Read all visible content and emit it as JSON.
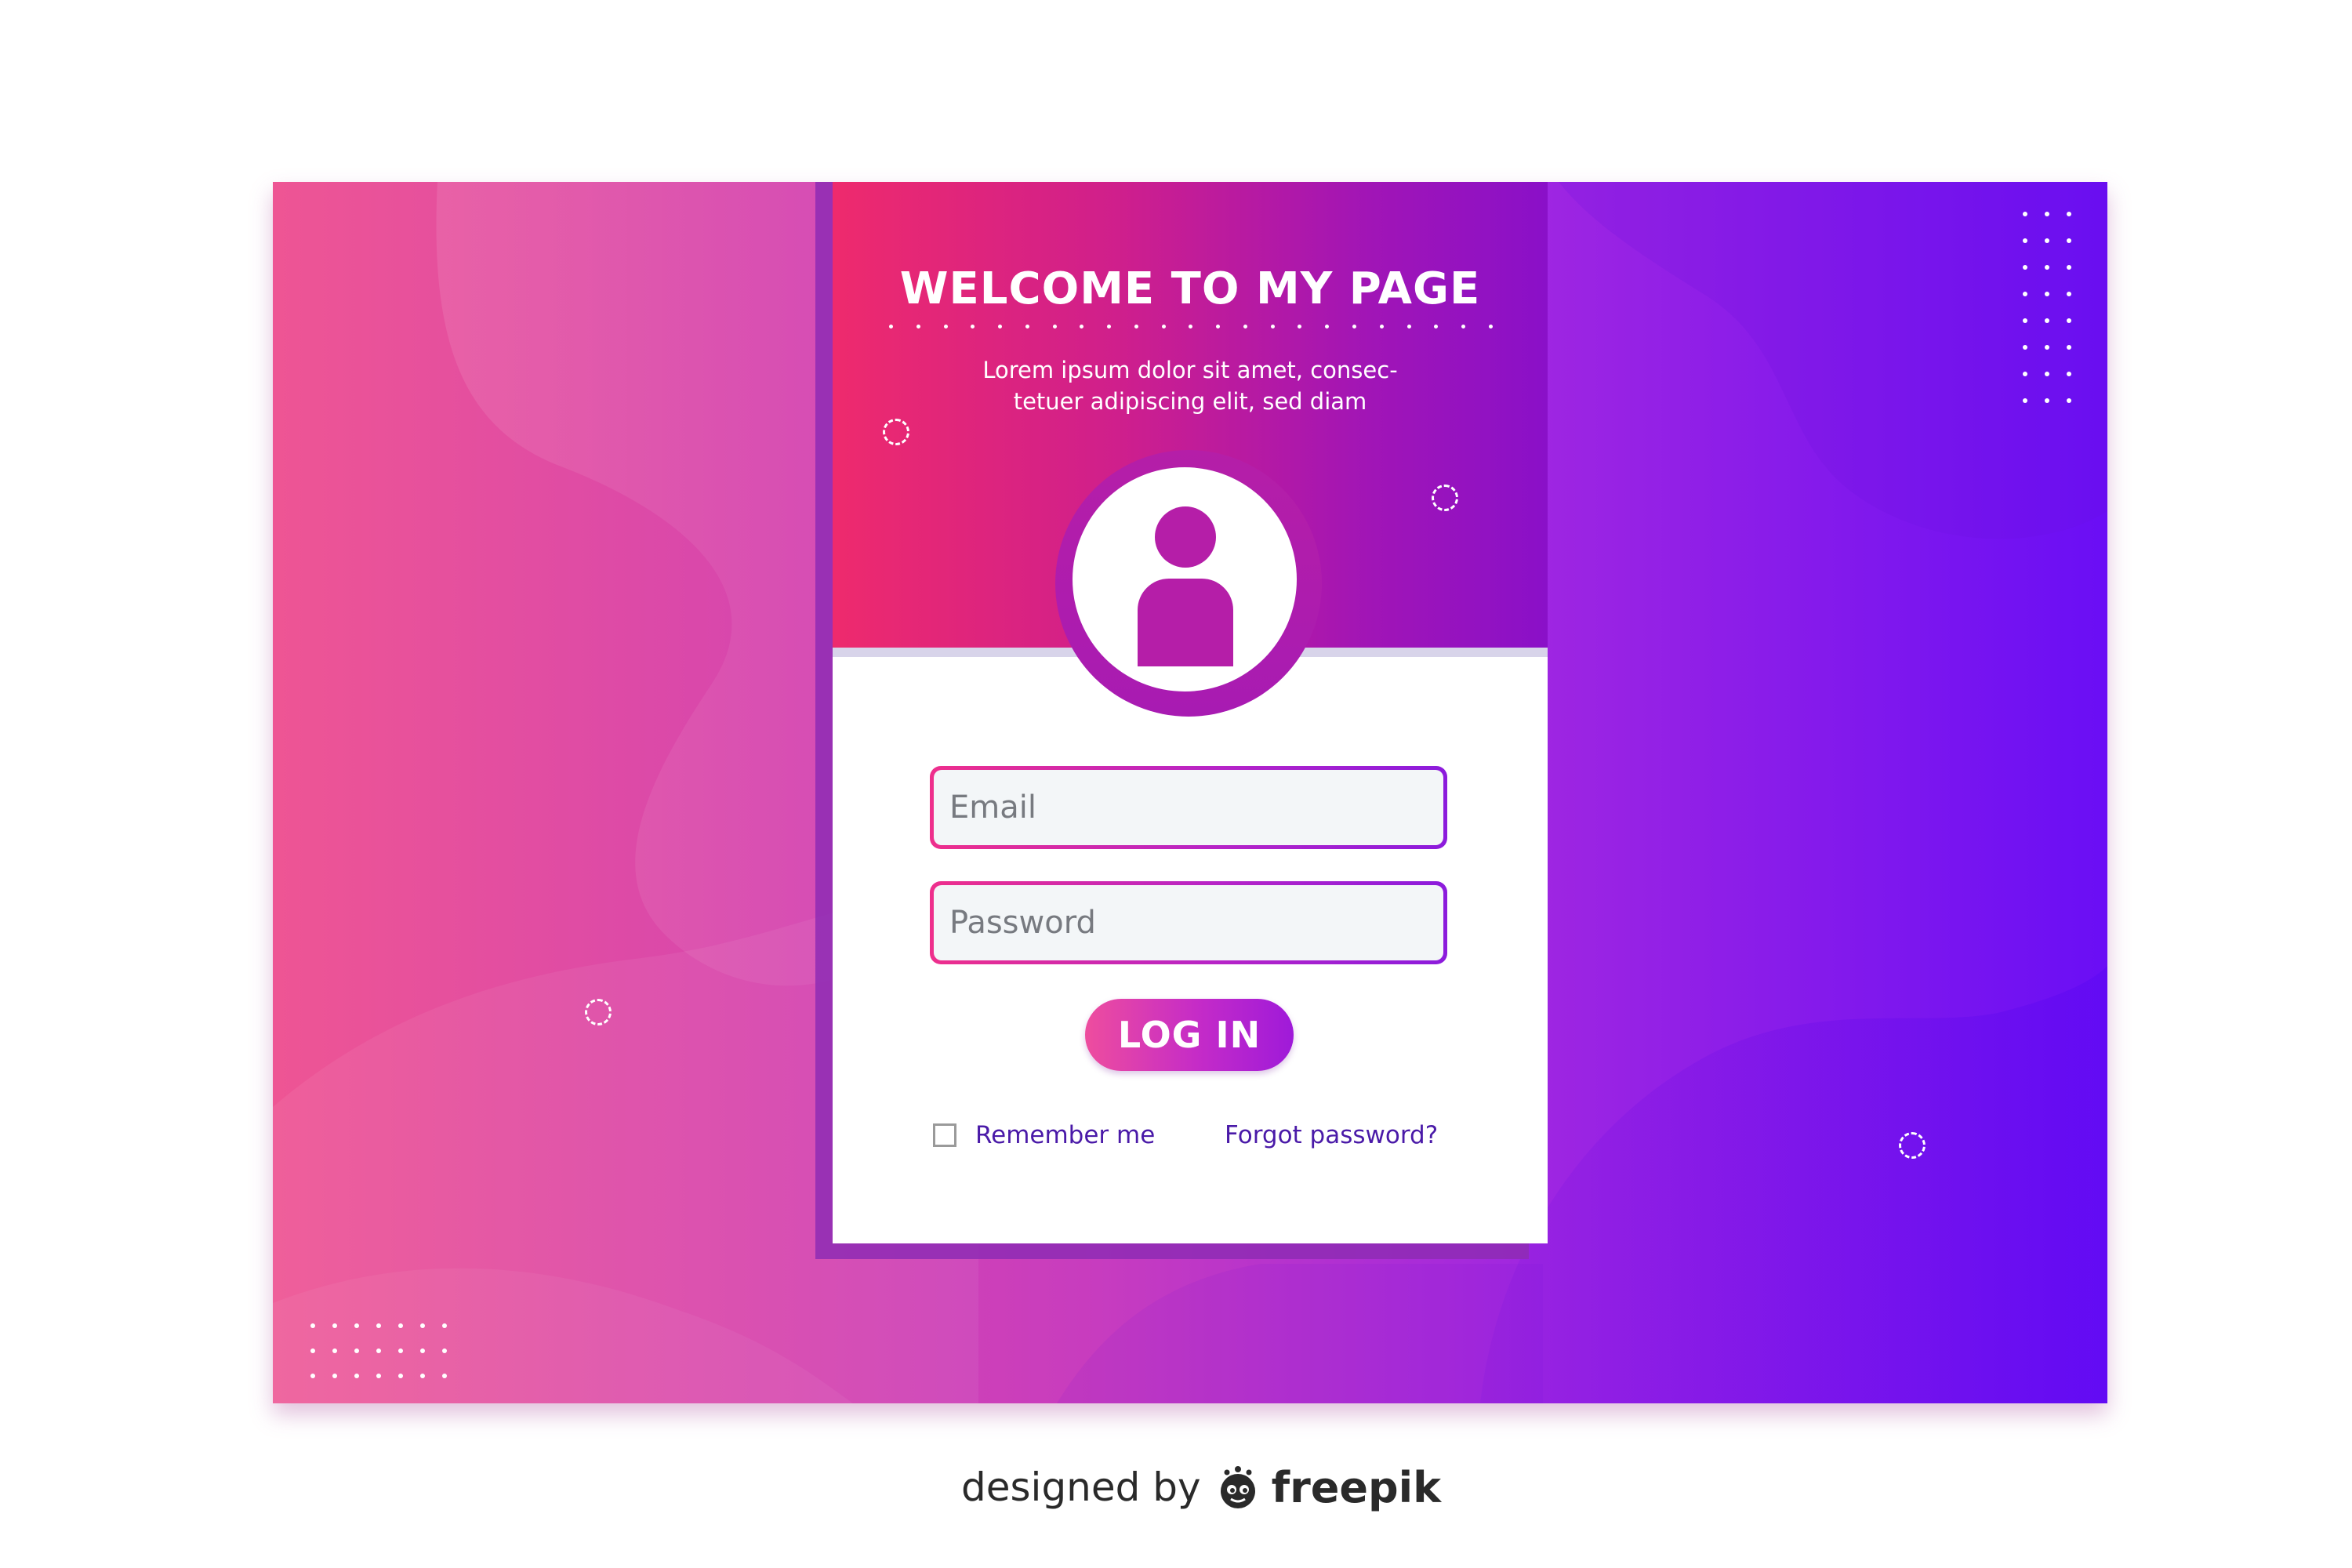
{
  "hero": {
    "title": "WELCOME TO MY PAGE",
    "subtitle_line1": "Lorem ipsum dolor sit amet, consec-",
    "subtitle_line2": "tetuer adipiscing elit, sed diam"
  },
  "avatar": {
    "icon": "user-icon"
  },
  "form": {
    "email_placeholder": "Email",
    "email_value": "",
    "password_placeholder": "Password",
    "password_value": "",
    "login_label": "LOG IN",
    "remember_label": "Remember me",
    "remember_checked": false,
    "forgot_label": "Forgot password?"
  },
  "credit": {
    "text": "designed by",
    "brand": "freepik",
    "logo_icon": "freepik-logo-icon"
  },
  "colors": {
    "gradient_start": "#ee5594",
    "gradient_end": "#6a0ef5",
    "header_start": "#ee2a6d",
    "header_end": "#8a10c8",
    "link_color": "#4a1aa8",
    "avatar_color": "#b51ea8"
  }
}
